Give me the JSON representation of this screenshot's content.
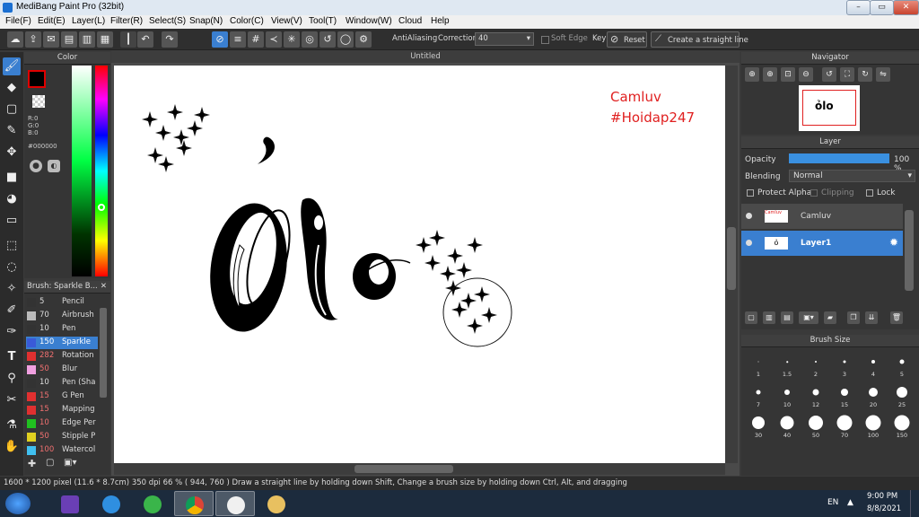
{
  "window": {
    "title": "MediBang Paint Pro (32bit)",
    "min": "–",
    "max": "▭",
    "close": "✕"
  },
  "menu": [
    "File(F)",
    "Edit(E)",
    "Layer(L)",
    "Filter(R)",
    "Select(S)",
    "Snap(N)",
    "Color(C)",
    "View(V)",
    "Tool(T)",
    "Window(W)",
    "Cloud",
    "Help"
  ],
  "toolbar": {
    "antialiasing_label": "AntiAliasing",
    "correction_label": "Correction",
    "correction_value": "40",
    "soft_edge_label": "Soft Edge",
    "key_label": "Key",
    "reset_label": "Reset",
    "straight_line_label": "Create a straight line"
  },
  "color_panel": {
    "title": "Color",
    "r": "R:0",
    "g": "G:0",
    "b": "B:0",
    "hex": "#000000",
    "fg_color": "#000000",
    "accent": "#e00000"
  },
  "brush_panel": {
    "title": "Brush: Sparkle B...",
    "items": [
      {
        "size": "5",
        "name": "Pencil",
        "color": "#333333",
        "selected": false
      },
      {
        "size": "70",
        "name": "Airbrush",
        "color": "#bbbbbb",
        "selected": false
      },
      {
        "size": "10",
        "name": "Pen",
        "color": "#333333",
        "selected": false
      },
      {
        "size": "150",
        "name": "Sparkle",
        "color": "#3a5ad8",
        "selected": true
      },
      {
        "size": "282",
        "name": "Rotation",
        "color": "#e03030",
        "selected": false
      },
      {
        "size": "50",
        "name": "Blur",
        "color": "#f0a0e0",
        "selected": false
      },
      {
        "size": "10",
        "name": "Pen (Sha",
        "color": "#333333",
        "selected": false
      },
      {
        "size": "15",
        "name": "G Pen",
        "color": "#e03030",
        "selected": false
      },
      {
        "size": "15",
        "name": "Mapping",
        "color": "#e03030",
        "selected": false
      },
      {
        "size": "10",
        "name": "Edge Per",
        "color": "#20c020",
        "selected": false
      },
      {
        "size": "50",
        "name": "Stipple P",
        "color": "#e0d020",
        "selected": false
      },
      {
        "size": "100",
        "name": "Watercol",
        "color": "#40c0f0",
        "selected": false
      }
    ]
  },
  "document": {
    "tab_title": "Untitled",
    "text_line1": "Camluv",
    "text_line2": "#Hoidap247",
    "text_color": "#e02020"
  },
  "navigator": {
    "title": "Navigator"
  },
  "layer_panel": {
    "title": "Layer",
    "opacity_label": "Opacity",
    "opacity_value": "100 %",
    "opacity": 1.0,
    "blending_label": "Blending",
    "blending_value": "Normal",
    "protect_alpha": "Protect Alpha",
    "clipping": "Clipping",
    "lock": "Lock",
    "layers": [
      {
        "name": "Camluv",
        "selected": false
      },
      {
        "name": "Layer1",
        "selected": true
      }
    ]
  },
  "brush_size_panel": {
    "title": "Brush Size",
    "sizes": [
      "1",
      "1.5",
      "2",
      "3",
      "4",
      "5",
      "7",
      "10",
      "12",
      "15",
      "20",
      "25",
      "30",
      "40",
      "50",
      "70",
      "100",
      "150"
    ]
  },
  "status": {
    "text": "1600 * 1200 pixel   (11.6 * 8.7cm)   350 dpi   66 %   ( 944, 760 )   Draw a straight line by holding down Shift, Change a brush size by holding down Ctrl, Alt, and dragging"
  },
  "taskbar": {
    "lang": "EN",
    "time": "9:00 PM",
    "date": "8/8/2021"
  }
}
